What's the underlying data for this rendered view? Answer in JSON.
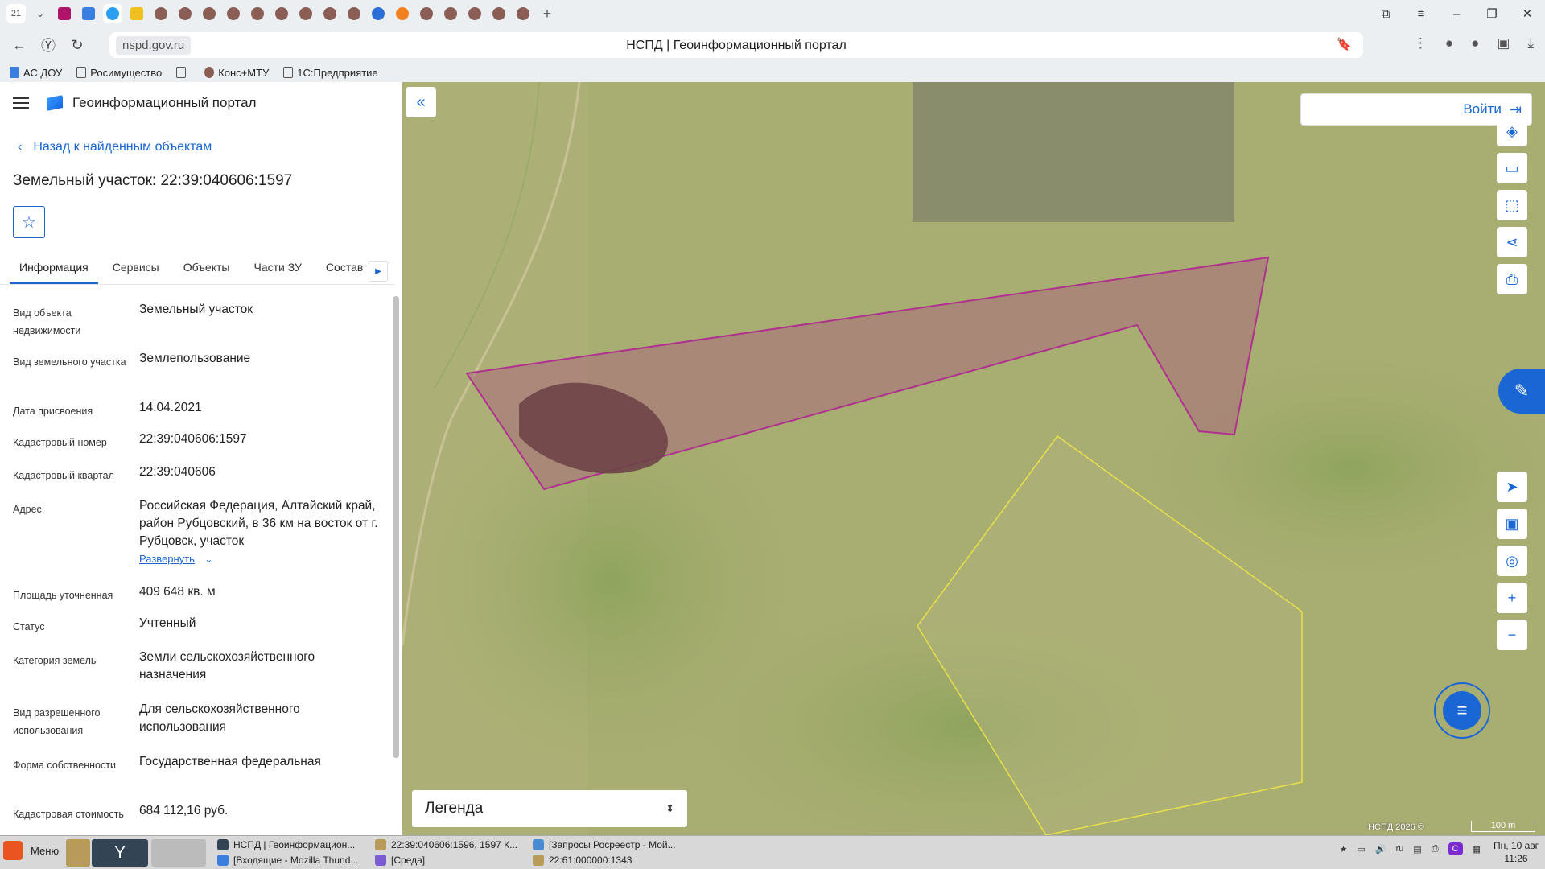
{
  "browser": {
    "tab_count": "21",
    "domain": "nspd.gov.ru",
    "page_title": "НСПД | Геоинформационный портал",
    "bookmarks": [
      "АС ДОУ",
      "Росимущество",
      "Конс+МТУ",
      "1С:Предприятие"
    ]
  },
  "panel": {
    "portal_name": "Геоинформационный портал",
    "back_label": "Назад к найденным объектам",
    "object_title": "Земельный участок: 22:39:040606:1597",
    "tabs": [
      "Информация",
      "Сервисы",
      "Объекты",
      "Части ЗУ",
      "Состав"
    ],
    "properties": [
      {
        "label": "Вид объекта недвижимости",
        "value": "Земельный участок"
      },
      {
        "label": "Вид земельного участка",
        "value": "Землепользование"
      },
      {
        "label": "Дата присвоения",
        "value": "14.04.2021"
      },
      {
        "label": "Кадастровый номер",
        "value": "22:39:040606:1597"
      },
      {
        "label": "Кадастровый квартал",
        "value": "22:39:040606"
      },
      {
        "label": "Адрес",
        "value": "Российская Федерация, Алтайский край, район Рубцовский, в 36 км на восток от г. Рубцовск, участок"
      },
      {
        "label": "Площадь уточненная",
        "value": "409 648 кв. м"
      },
      {
        "label": "Статус",
        "value": "Учтенный"
      },
      {
        "label": "Категория земель",
        "value": "Земли сельскохозяйственного назначения"
      },
      {
        "label": "Вид разрешенного использования",
        "value": "Для сельскохозяйственного использования"
      },
      {
        "label": "Форма собственности",
        "value": "Государственная федеральная"
      },
      {
        "label": "Кадастровая стоимость",
        "value": "684 112,16 руб."
      }
    ],
    "expand_label": "Развернуть"
  },
  "map": {
    "login_label": "Войти",
    "legend_label": "Легенда",
    "copyright": "НСПД 2026 ©",
    "scale": "100 m",
    "parcel_color": "#b0308f",
    "neighbor_color": "#e8e04a"
  },
  "taskbar": {
    "menu_label": "Меню",
    "tasks": [
      "НСПД | Геоинформацион...",
      "[Входящие - Mozilla Thund...",
      "22:39:040606:1596, 1597 К...",
      "[Среда]",
      "[Запросы Росреестр - Мой...",
      "22:61:000000:1343"
    ],
    "lang": "ru",
    "date": "Пн, 10 авг",
    "time": "11:26"
  }
}
